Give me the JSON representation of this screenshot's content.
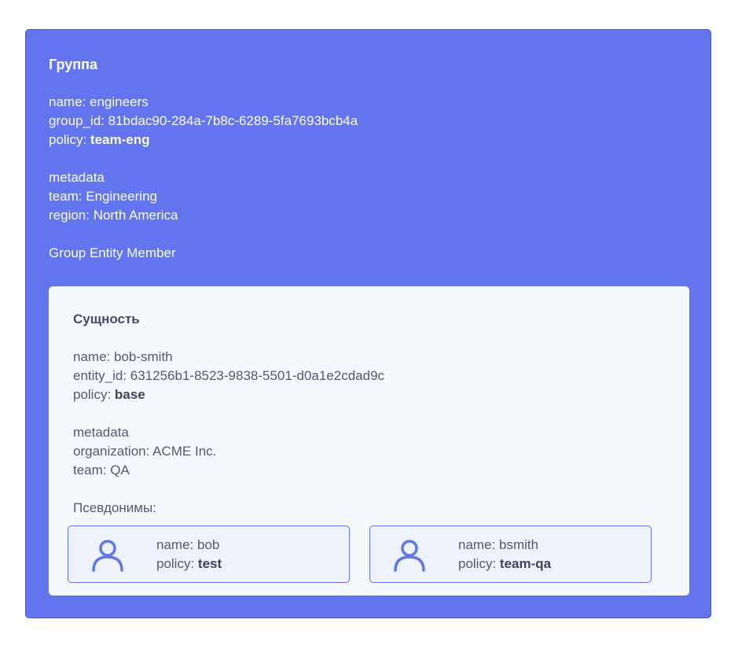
{
  "group": {
    "title": "Группа",
    "name_label": "name: ",
    "name": "engineers",
    "group_id_label": "group_id: ",
    "group_id": "81bdac90-284a-7b8c-6289-5fa7693bcb4a",
    "policy_label": "policy: ",
    "policy": "team-eng",
    "metadata_heading": "metadata",
    "metadata": [
      {
        "label": "team: ",
        "value": "Engineering"
      },
      {
        "label": "region: ",
        "value": "North America"
      }
    ],
    "members_heading": "Group Entity Member"
  },
  "entity": {
    "title": "Сущность",
    "name_label": "name: ",
    "name": "bob-smith",
    "entity_id_label": "entity_id: ",
    "entity_id": "631256b1-8523-9838-5501-d0a1e2cdad9c",
    "policy_label": "policy: ",
    "policy": "base",
    "metadata_heading": "metadata",
    "metadata": [
      {
        "label": "organization: ",
        "value": "ACME Inc."
      },
      {
        "label": "team: ",
        "value": "QA"
      }
    ],
    "aliases_heading": "Псевдонимы:",
    "aliases": [
      {
        "icon": "user-icon",
        "name_label": "name: ",
        "name": "bob",
        "policy_label": "policy: ",
        "policy": "test"
      },
      {
        "icon": "user-icon",
        "name_label": "name: ",
        "name": "bsmith",
        "policy_label": "policy: ",
        "policy": "team-qa"
      }
    ]
  },
  "colors": {
    "group_background": "#6274ee",
    "entity_background": "#f5f8fc",
    "alias_border": "#6274ee",
    "alias_background": "#eef2fb"
  }
}
